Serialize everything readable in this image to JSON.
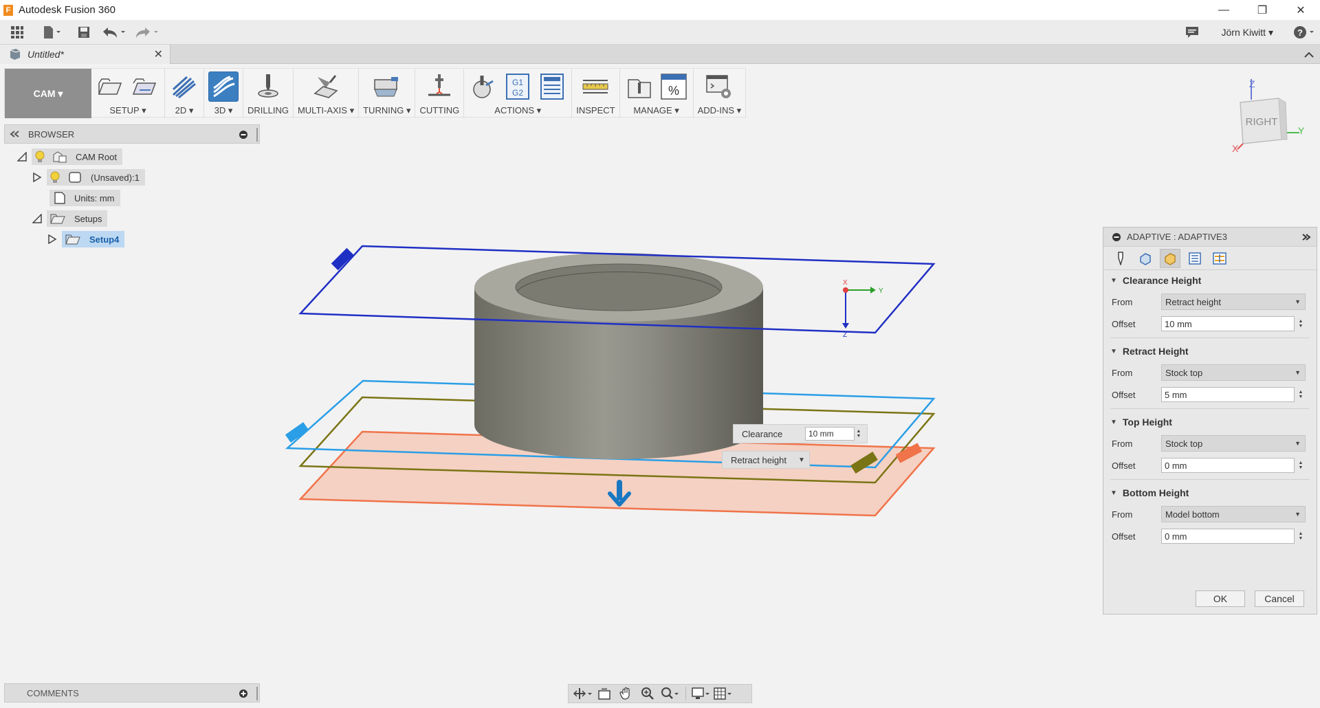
{
  "app": {
    "title": "Autodesk Fusion 360",
    "logo_letter": "F"
  },
  "window_controls": {
    "minimize": "—",
    "restore": "❐",
    "close": "✕"
  },
  "qat": {
    "user_name": "Jörn Kiwitt ▾"
  },
  "document_tab": {
    "label": "Untitled*",
    "close": "✕"
  },
  "ribbon": {
    "workspace": "CAM ▾",
    "groups": [
      {
        "key": "setup",
        "label": "SETUP ▾"
      },
      {
        "key": "2d",
        "label": "2D ▾"
      },
      {
        "key": "3d",
        "label": "3D ▾"
      },
      {
        "key": "drilling",
        "label": "DRILLING"
      },
      {
        "key": "multiaxis",
        "label": "MULTI-AXIS ▾"
      },
      {
        "key": "turning",
        "label": "TURNING ▾"
      },
      {
        "key": "cutting",
        "label": "CUTTING"
      },
      {
        "key": "actions",
        "label": "ACTIONS ▾"
      },
      {
        "key": "inspect",
        "label": "INSPECT"
      },
      {
        "key": "manage",
        "label": "MANAGE ▾"
      },
      {
        "key": "addins",
        "label": "ADD-INS ▾"
      }
    ],
    "actions_g_code": "G1\nG2"
  },
  "viewcube": {
    "face": "RIGHT",
    "axis_x": "X",
    "axis_y": "Y",
    "axis_z": "Z"
  },
  "browser": {
    "title": "BROWSER",
    "tree": {
      "cam_root": "CAM Root",
      "unsaved": "(Unsaved):1",
      "units": "Units: mm",
      "setups": "Setups",
      "setup4": "Setup4"
    }
  },
  "comments": {
    "title": "COMMENTS"
  },
  "canvas": {
    "clearance_label": "Clearance",
    "clearance_value": "10 mm",
    "retract_dropdown": "Retract height",
    "origin_x": "X",
    "origin_y": "Y",
    "origin_z": "Z"
  },
  "dialog": {
    "title": "ADAPTIVE : ADAPTIVE3",
    "sections": {
      "clearance": {
        "title": "Clearance Height",
        "from_label": "From",
        "from_value": "Retract height",
        "offset_label": "Offset",
        "offset_value": "10 mm"
      },
      "retract": {
        "title": "Retract Height",
        "from_label": "From",
        "from_value": "Stock top",
        "offset_label": "Offset",
        "offset_value": "5 mm"
      },
      "top": {
        "title": "Top Height",
        "from_label": "From",
        "from_value": "Stock top",
        "offset_label": "Offset",
        "offset_value": "0 mm"
      },
      "bottom": {
        "title": "Bottom Height",
        "from_label": "From",
        "from_value": "Model bottom",
        "offset_label": "Offset",
        "offset_value": "0 mm"
      }
    },
    "ok_label": "OK",
    "cancel_label": "Cancel"
  },
  "colors": {
    "clearance_plane": "#1f2fc4",
    "retract_plane": "#2a9ee6",
    "top_plane": "#7a7414",
    "bottom_plane": "#f0734a",
    "bottom_plane_fill": "#f5cbbb",
    "accent_blue": "#3c7fc1"
  }
}
